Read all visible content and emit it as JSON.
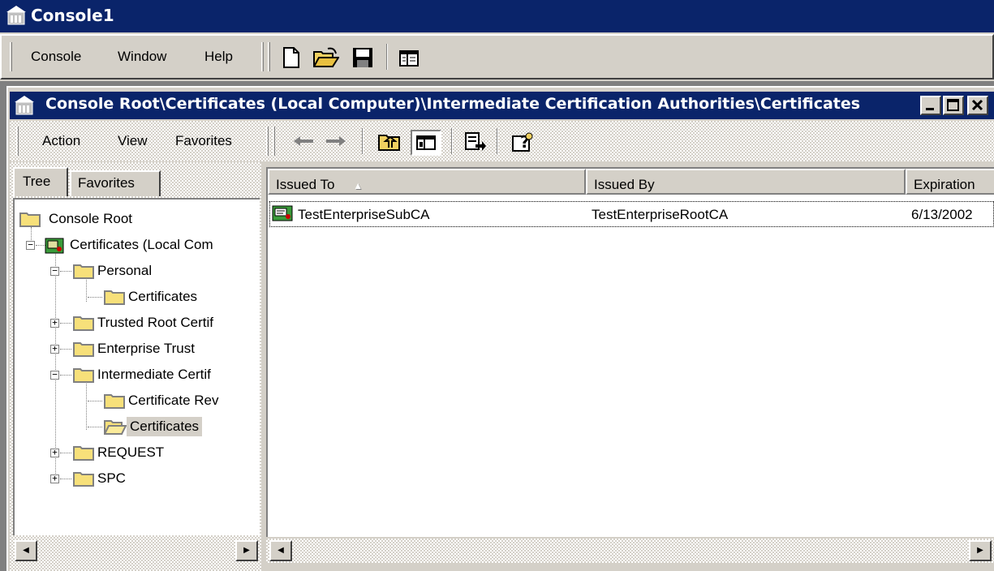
{
  "app": {
    "title": "Console1"
  },
  "menu": [
    {
      "label": "Console"
    },
    {
      "label": "Window"
    },
    {
      "label": "Help"
    }
  ],
  "toolbar_icons": [
    "new-document-icon",
    "open-folder-icon",
    "save-icon",
    "show-hide-tree-icon"
  ],
  "child_window": {
    "title": "Console Root\\Certificates (Local Computer)\\Intermediate Certification Authorities\\Certificates",
    "menu": [
      {
        "label": "Action"
      },
      {
        "label": "View"
      },
      {
        "label": "Favorites"
      }
    ],
    "toolbar_icons": [
      "back-arrow-icon",
      "forward-arrow-icon",
      "up-one-level-icon",
      "show-hide-tree-icon",
      "export-list-icon",
      "help-icon"
    ]
  },
  "tabs": [
    {
      "label": "Tree",
      "active": true
    },
    {
      "label": "Favorites",
      "active": false
    }
  ],
  "tree": [
    {
      "label": "Console Root",
      "level": 0,
      "expander": "none",
      "icon": "folder-icon"
    },
    {
      "label": "Certificates (Local Com",
      "level": 1,
      "expander": "minus",
      "icon": "certificate-snapin-icon"
    },
    {
      "label": "Personal",
      "level": 2,
      "expander": "minus",
      "icon": "folder-icon"
    },
    {
      "label": "Certificates",
      "level": 3,
      "expander": "none",
      "icon": "folder-icon"
    },
    {
      "label": "Trusted Root Certif",
      "level": 2,
      "expander": "plus",
      "icon": "folder-icon"
    },
    {
      "label": "Enterprise Trust",
      "level": 2,
      "expander": "plus",
      "icon": "folder-icon"
    },
    {
      "label": "Intermediate Certif",
      "level": 2,
      "expander": "minus",
      "icon": "folder-icon"
    },
    {
      "label": "Certificate Rev",
      "level": 3,
      "expander": "none",
      "icon": "folder-icon"
    },
    {
      "label": "Certificates",
      "level": 3,
      "expander": "none",
      "icon": "open-folder-icon",
      "selected": true
    },
    {
      "label": "REQUEST",
      "level": 2,
      "expander": "plus",
      "icon": "folder-icon"
    },
    {
      "label": "SPC",
      "level": 2,
      "expander": "plus",
      "icon": "folder-icon"
    }
  ],
  "list": {
    "columns": [
      {
        "label": "Issued To",
        "sort_indicator": "▲"
      },
      {
        "label": "Issued By"
      },
      {
        "label": "Expiration"
      }
    ],
    "rows": [
      {
        "issued_to": "TestEnterpriseSubCA",
        "issued_by": "TestEnterpriseRootCA",
        "expiration": "6/13/2002",
        "icon": "certificate-icon"
      }
    ]
  },
  "colors": {
    "titlebar": "#0a246a",
    "face": "#d4d0c8",
    "selection": "#d4d0c8"
  }
}
